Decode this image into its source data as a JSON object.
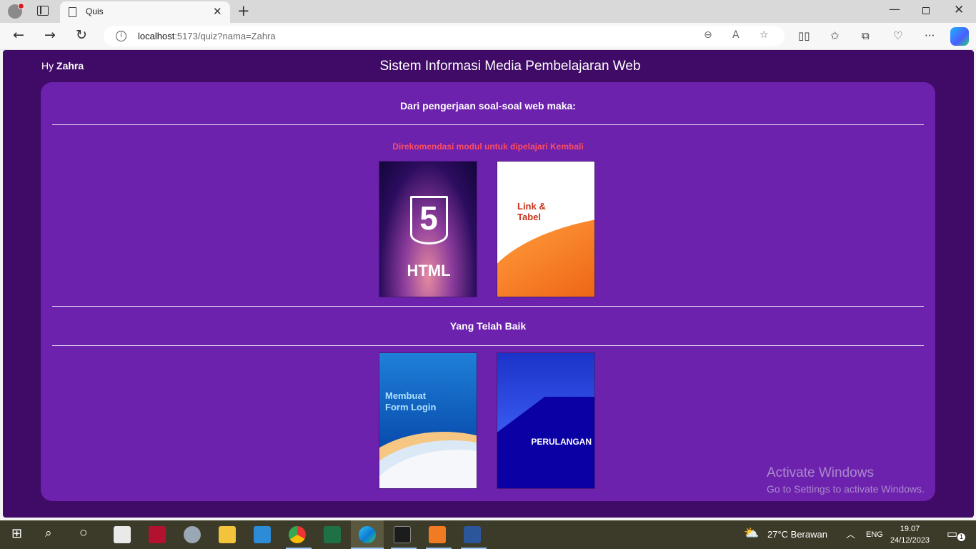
{
  "browser": {
    "tab_title": "Quis",
    "url_host": "localhost",
    "url_rest": ":5173/quiz?nama=Zahra",
    "new_tab": "+",
    "close_tab": "✕"
  },
  "header": {
    "greeting_prefix": "Hy",
    "user_name": "Zahra",
    "site_title": "Sistem Informasi Media Pembelajaran Web"
  },
  "result": {
    "heading": "Dari pengerjaan soal-soal web maka:",
    "recommend_label": "Direkomendasi modul untuk dipelajari Kembali",
    "recommended_modules": [
      {
        "title_line1": "5",
        "title_line2": "HTML"
      },
      {
        "title_line1": "Link &",
        "title_line2": "Tabel"
      }
    ],
    "good_heading": "Yang Telah Baik",
    "good_modules": [
      {
        "title_line1": "Membuat",
        "title_line2": "Form Login"
      },
      {
        "title_line1": "PERULANGAN"
      }
    ]
  },
  "watermark": {
    "line1": "Activate Windows",
    "line2": "Go to Settings to activate Windows."
  },
  "taskbar": {
    "weather": "27°C  Berawan",
    "language": "ENG",
    "time": "19.07",
    "date": "24/12/2023",
    "notifications": "1"
  },
  "colors": {
    "page_bg": "#3f0b66",
    "card_bg": "#6d22ad",
    "recommend_text": "#ff4d5e"
  }
}
